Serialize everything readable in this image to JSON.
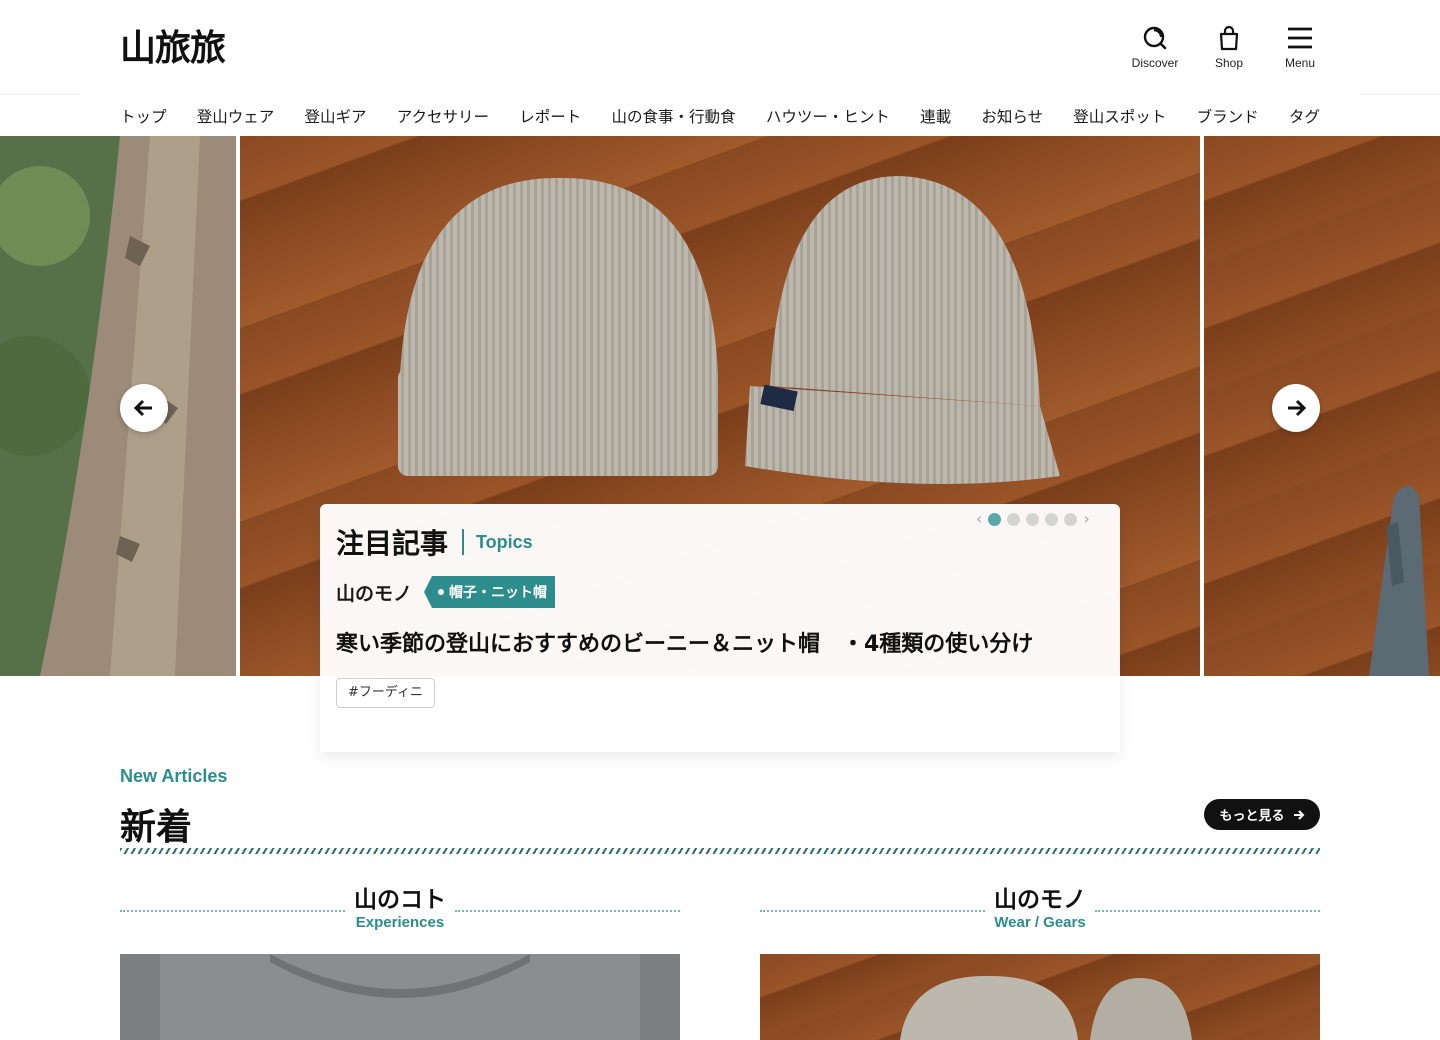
{
  "header": {
    "logo_text": "山旅旅",
    "buttons": [
      {
        "label": "Discover",
        "icon": "discover-search-icon"
      },
      {
        "label": "Shop",
        "icon": "shopping-bag-icon"
      },
      {
        "label": "Menu",
        "icon": "hamburger-menu-icon"
      }
    ]
  },
  "nav": {
    "items": [
      "トップ",
      "登山ウェア",
      "登山ギア",
      "アクセサリー",
      "レポート",
      "山の食事・行動食",
      "ハウツー・ヒント",
      "連載",
      "お知らせ",
      "登山スポット",
      "ブランド",
      "タグ"
    ]
  },
  "hero": {
    "prev_icon": "arrow-left-icon",
    "next_icon": "arrow-right-icon",
    "slide_count": 5,
    "active_slide": 1
  },
  "topics": {
    "heading_ja": "注目記事",
    "heading_en": "Topics",
    "category": "山のモノ",
    "category_tag": "帽子・ニット帽",
    "title": "寒い季節の登山におすすめのビーニー＆ニット帽　・4種類の使い分け",
    "hashtag": "#フーディニ"
  },
  "new_articles": {
    "heading_en": "New Articles",
    "heading_ja": "新着",
    "more_label": "もっと見る",
    "columns": [
      {
        "ja": "山のコト",
        "en": "Experiences"
      },
      {
        "ja": "山のモノ",
        "en": "Wear / Gears"
      }
    ]
  },
  "colors": {
    "accent": "#2d8c8c",
    "text": "#111111",
    "button_dark": "#111111"
  }
}
